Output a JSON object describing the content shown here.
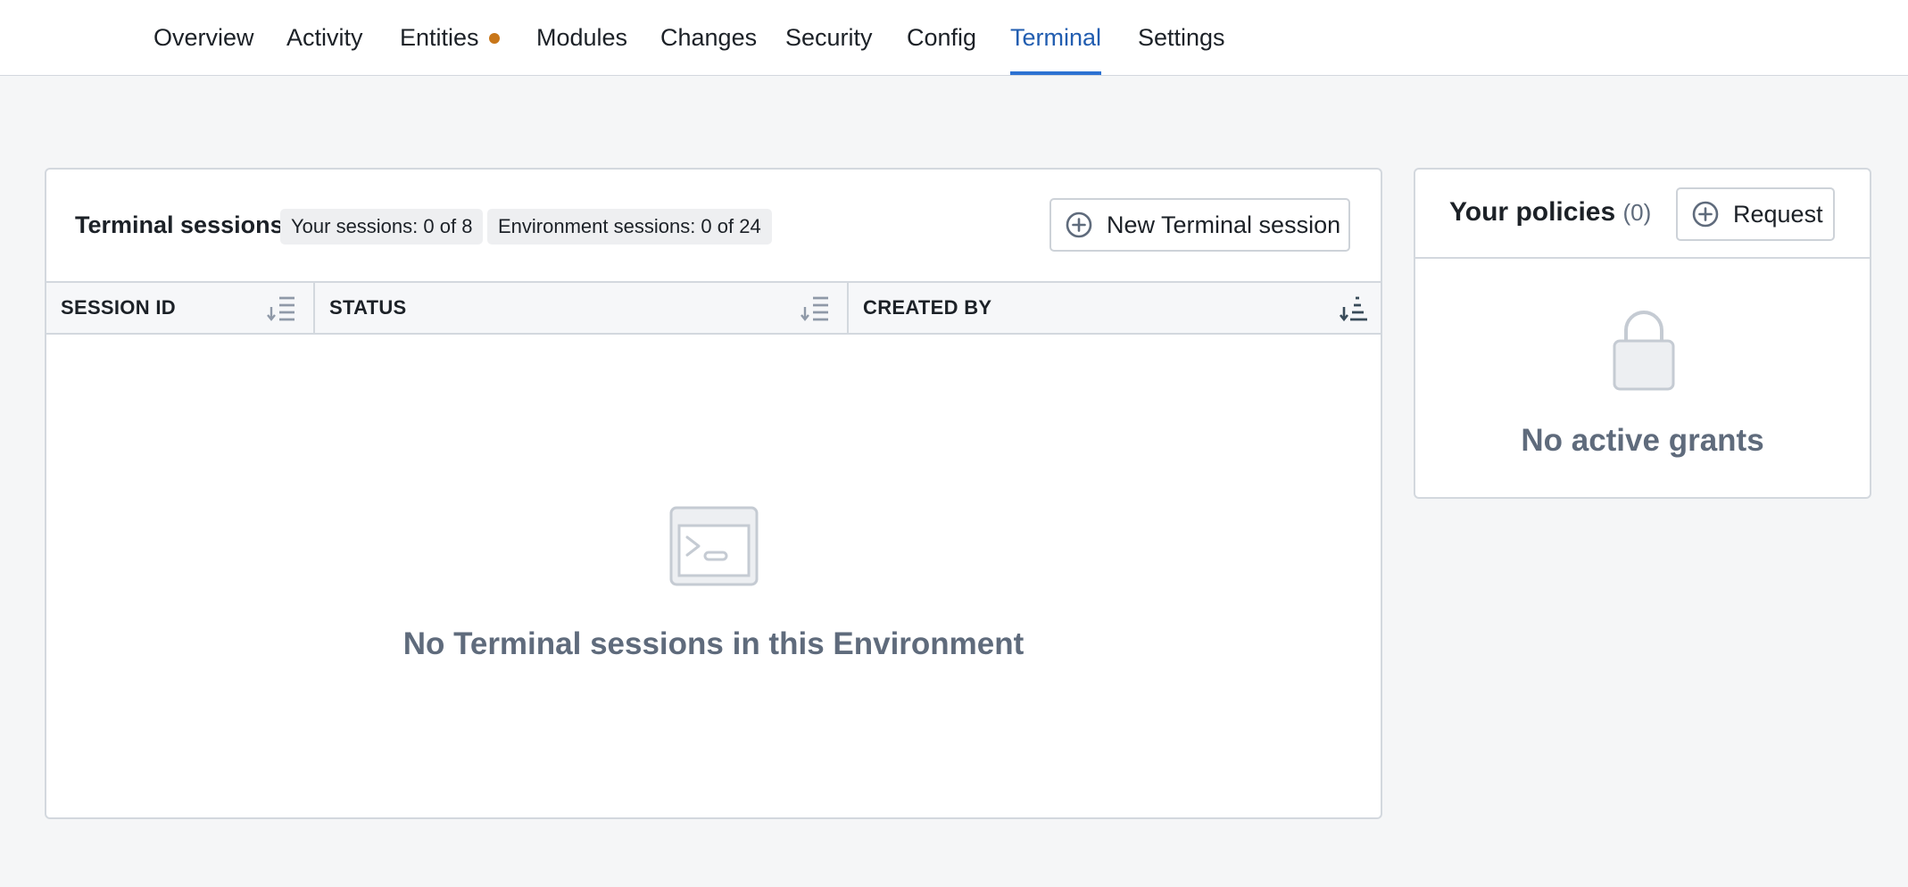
{
  "nav": {
    "tabs": [
      {
        "label": "Overview"
      },
      {
        "label": "Activity"
      },
      {
        "label": "Entities",
        "indicator": "orange-dot"
      },
      {
        "label": "Modules"
      },
      {
        "label": "Changes"
      },
      {
        "label": "Security"
      },
      {
        "label": "Config"
      },
      {
        "label": "Terminal",
        "active": true
      },
      {
        "label": "Settings"
      }
    ],
    "active_color": "#215db0",
    "indicator_color": "#c87619"
  },
  "sessions": {
    "title": "Terminal sessions",
    "your_sessions_badge": "Your sessions: 0 of 8",
    "environment_sessions_badge": "Environment sessions: 0 of 24",
    "new_button_label": "New Terminal session",
    "new_button_icon": "plus-circle-icon",
    "columns": [
      {
        "label": "SESSION ID",
        "sort_icon": "sort-desc-icon"
      },
      {
        "label": "STATUS",
        "sort_icon": "sort-desc-icon"
      },
      {
        "label": "CREATED BY",
        "sort_icon": "sort-asc-icon"
      }
    ],
    "rows": [],
    "empty_icon": "terminal-icon",
    "empty_message": "No Terminal sessions in this Environment"
  },
  "policies": {
    "title": "Your policies",
    "count": "(0)",
    "request_button_label": "Request",
    "request_button_icon": "plus-circle-icon",
    "empty_icon": "lock-icon",
    "empty_message": "No active grants"
  }
}
